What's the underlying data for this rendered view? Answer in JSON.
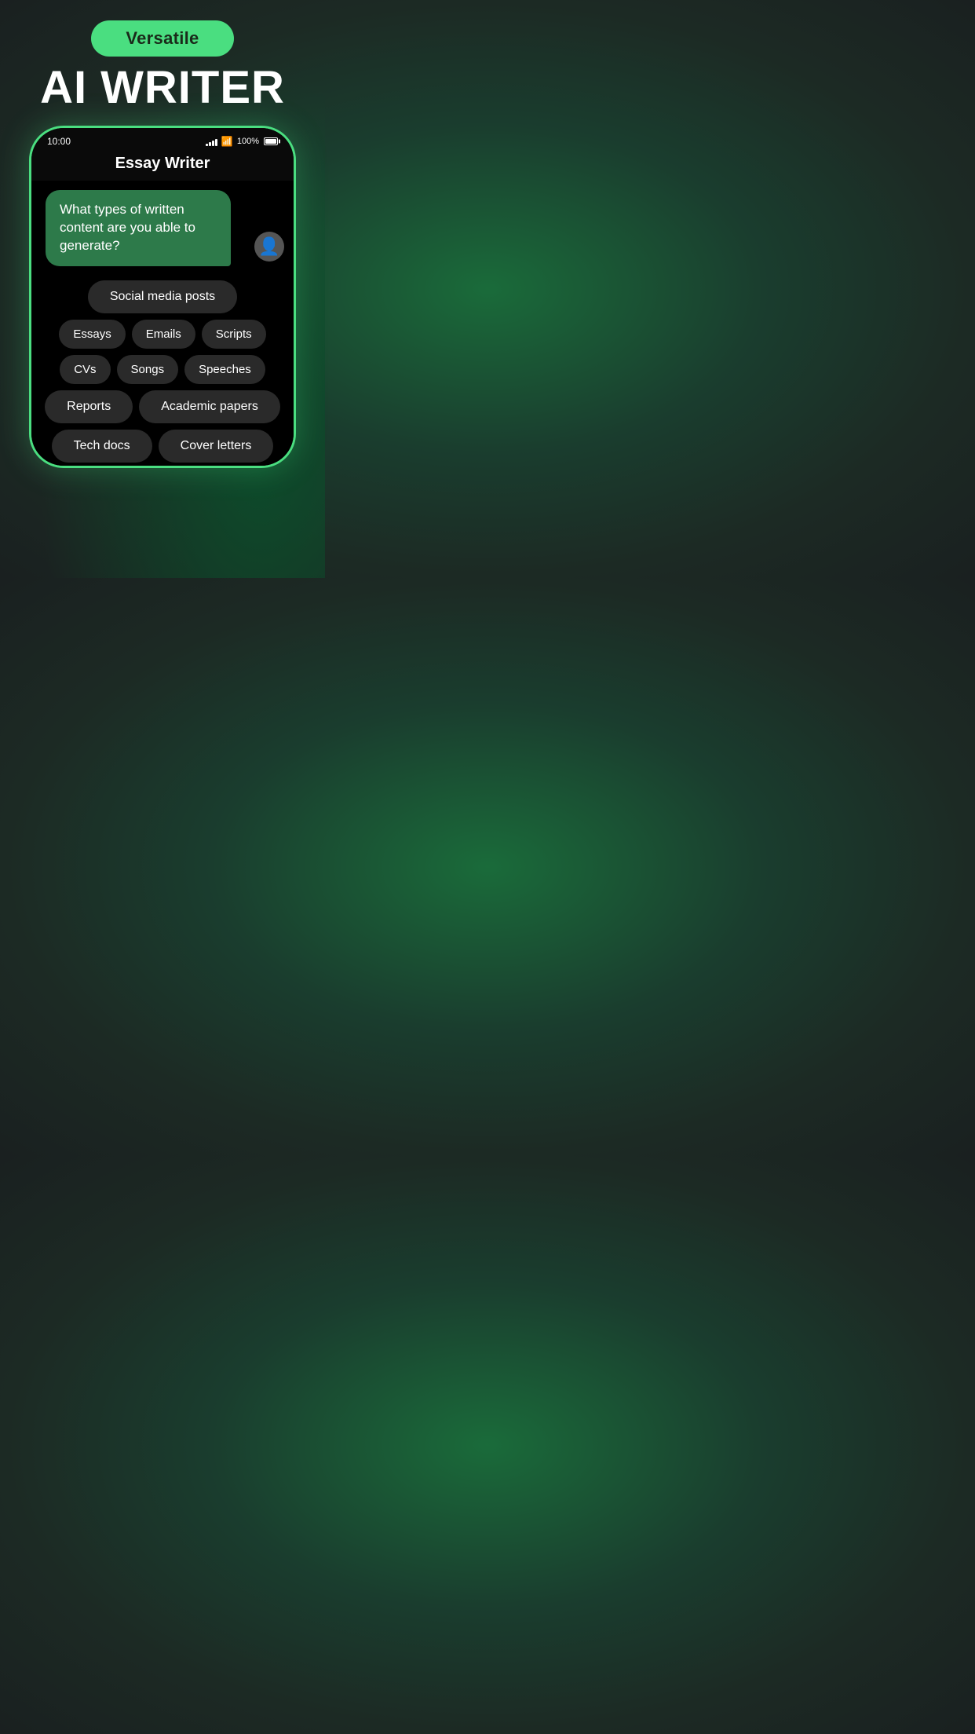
{
  "badge": {
    "label": "Versatile"
  },
  "title": {
    "main": "AI WRITER"
  },
  "phone": {
    "status_bar": {
      "time": "10:00",
      "battery_pct": "100%"
    },
    "header": {
      "title": "Essay Writer"
    },
    "chat": {
      "message": "What types of written content are you able to generate?"
    },
    "chips": [
      [
        "Social media posts"
      ],
      [
        "Essays",
        "Emails",
        "Scripts"
      ],
      [
        "CVs",
        "Songs",
        "Speeches"
      ],
      [
        "Reports",
        "Academic papers"
      ],
      [
        "Tech docs",
        "Cover letters"
      ]
    ]
  }
}
